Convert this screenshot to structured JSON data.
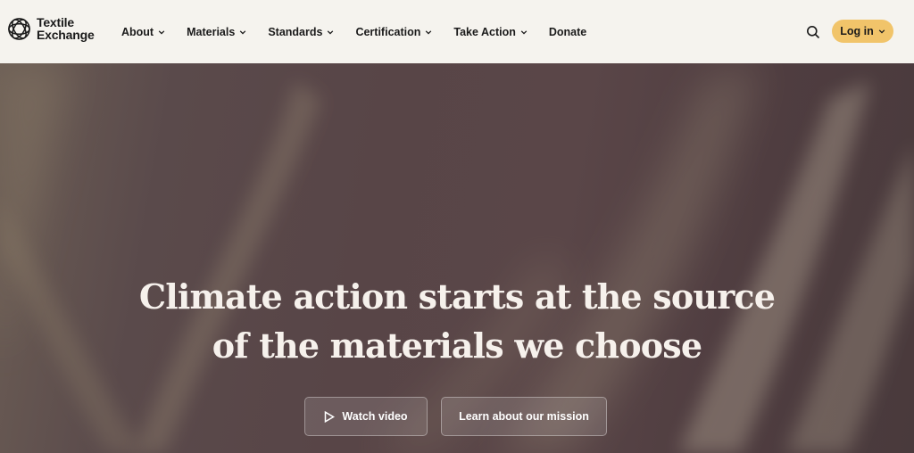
{
  "brand": {
    "line1": "Textile",
    "line2": "Exchange",
    "logo_icon": "globe-knot-logo"
  },
  "nav": {
    "items": [
      {
        "label": "About",
        "has_dropdown": true
      },
      {
        "label": "Materials",
        "has_dropdown": true
      },
      {
        "label": "Standards",
        "has_dropdown": true
      },
      {
        "label": "Certification",
        "has_dropdown": true
      },
      {
        "label": "Take Action",
        "has_dropdown": true
      },
      {
        "label": "Donate",
        "has_dropdown": false
      }
    ],
    "search_icon": "search-icon",
    "login_label": "Log in",
    "login_color": "#f1c46a"
  },
  "hero": {
    "headline_line1": "Climate action starts at the source",
    "headline_line2": "of the materials we choose",
    "watch_video_label": "Watch video",
    "mission_label": "Learn about our mission",
    "play_icon": "play-icon"
  },
  "colors": {
    "header_bg": "#f5f3ee",
    "hero_bg": "#584547",
    "text_dark": "#1a1a1a"
  }
}
